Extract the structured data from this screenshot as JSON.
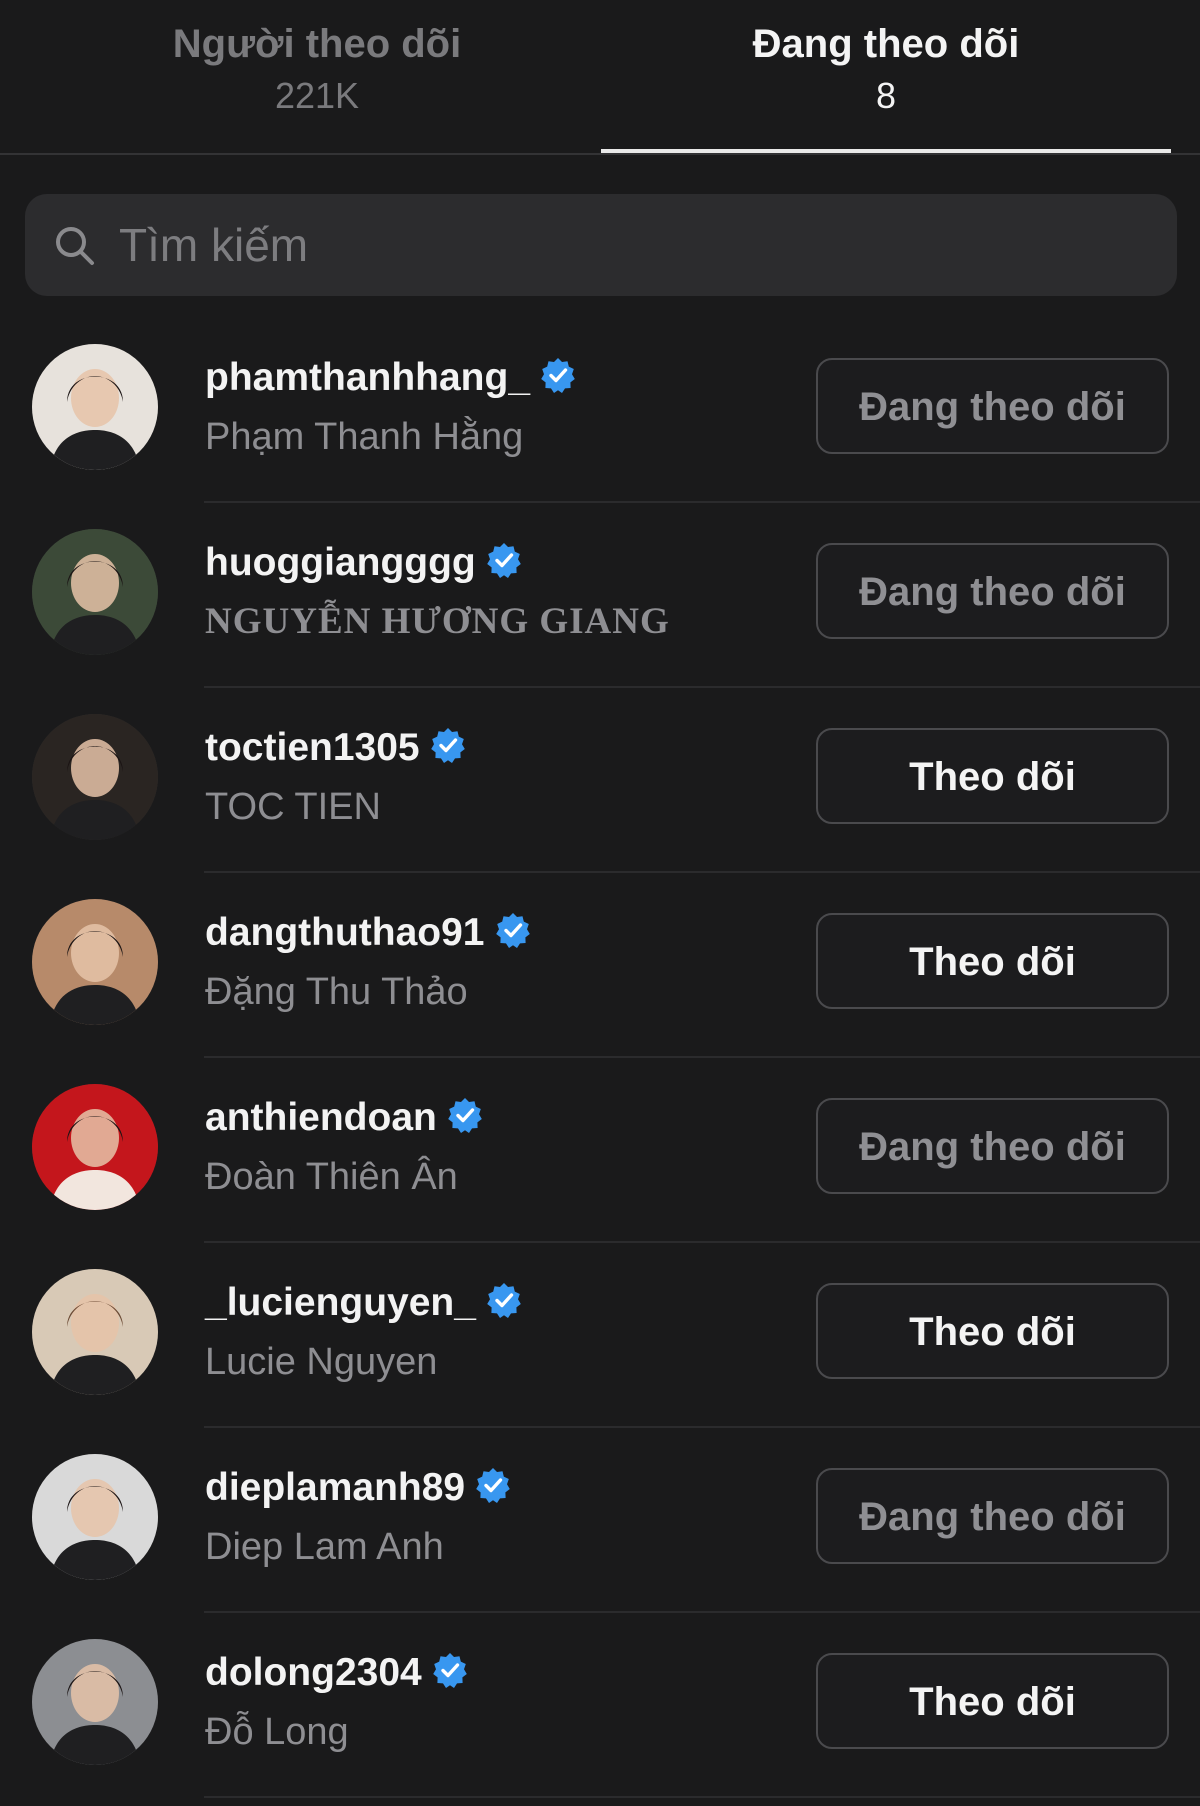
{
  "tabs": {
    "followers": {
      "label": "Người theo dõi",
      "count": "221K"
    },
    "following": {
      "label": "Đang theo dõi",
      "count": "8"
    }
  },
  "search": {
    "placeholder": "Tìm kiếm",
    "value": ""
  },
  "accent": {
    "verified": "#3897f0"
  },
  "list": [
    {
      "username": "phamthanhhang_",
      "fullname": "Phạm Thanh Hằng",
      "button": "Đang theo dõi",
      "state": "following",
      "avatar_color": "#e7e2dc"
    },
    {
      "username": "huoggiangggg",
      "fullname": "NGUYỄN HƯƠNG GIANG",
      "button": "Đang theo dõi",
      "state": "following",
      "avatar_color": "#3c4a38"
    },
    {
      "username": "toctien1305",
      "fullname": "TOC TIEN",
      "button": "Theo dõi",
      "state": "follow",
      "avatar_color": "#2a2522"
    },
    {
      "username": "dangthuthao91",
      "fullname": "Đặng Thu Thảo",
      "button": "Theo dõi",
      "state": "follow",
      "avatar_color": "#b78a6a"
    },
    {
      "username": "anthiendoan",
      "fullname": "Đoàn Thiên Ân",
      "button": "Đang theo dõi",
      "state": "following",
      "avatar_color": "#c4161c"
    },
    {
      "username": "_lucienguyen_",
      "fullname": "Lucie Nguyen",
      "button": "Theo dõi",
      "state": "follow",
      "avatar_color": "#d8c9b6"
    },
    {
      "username": "dieplamanh89",
      "fullname": "Diep Lam Anh",
      "button": "Đang theo dõi",
      "state": "following",
      "avatar_color": "#d9d9d9"
    },
    {
      "username": "dolong2304",
      "fullname": "Đỗ Long",
      "button": "Theo dõi",
      "state": "follow",
      "avatar_color": "#8c8e92"
    }
  ]
}
